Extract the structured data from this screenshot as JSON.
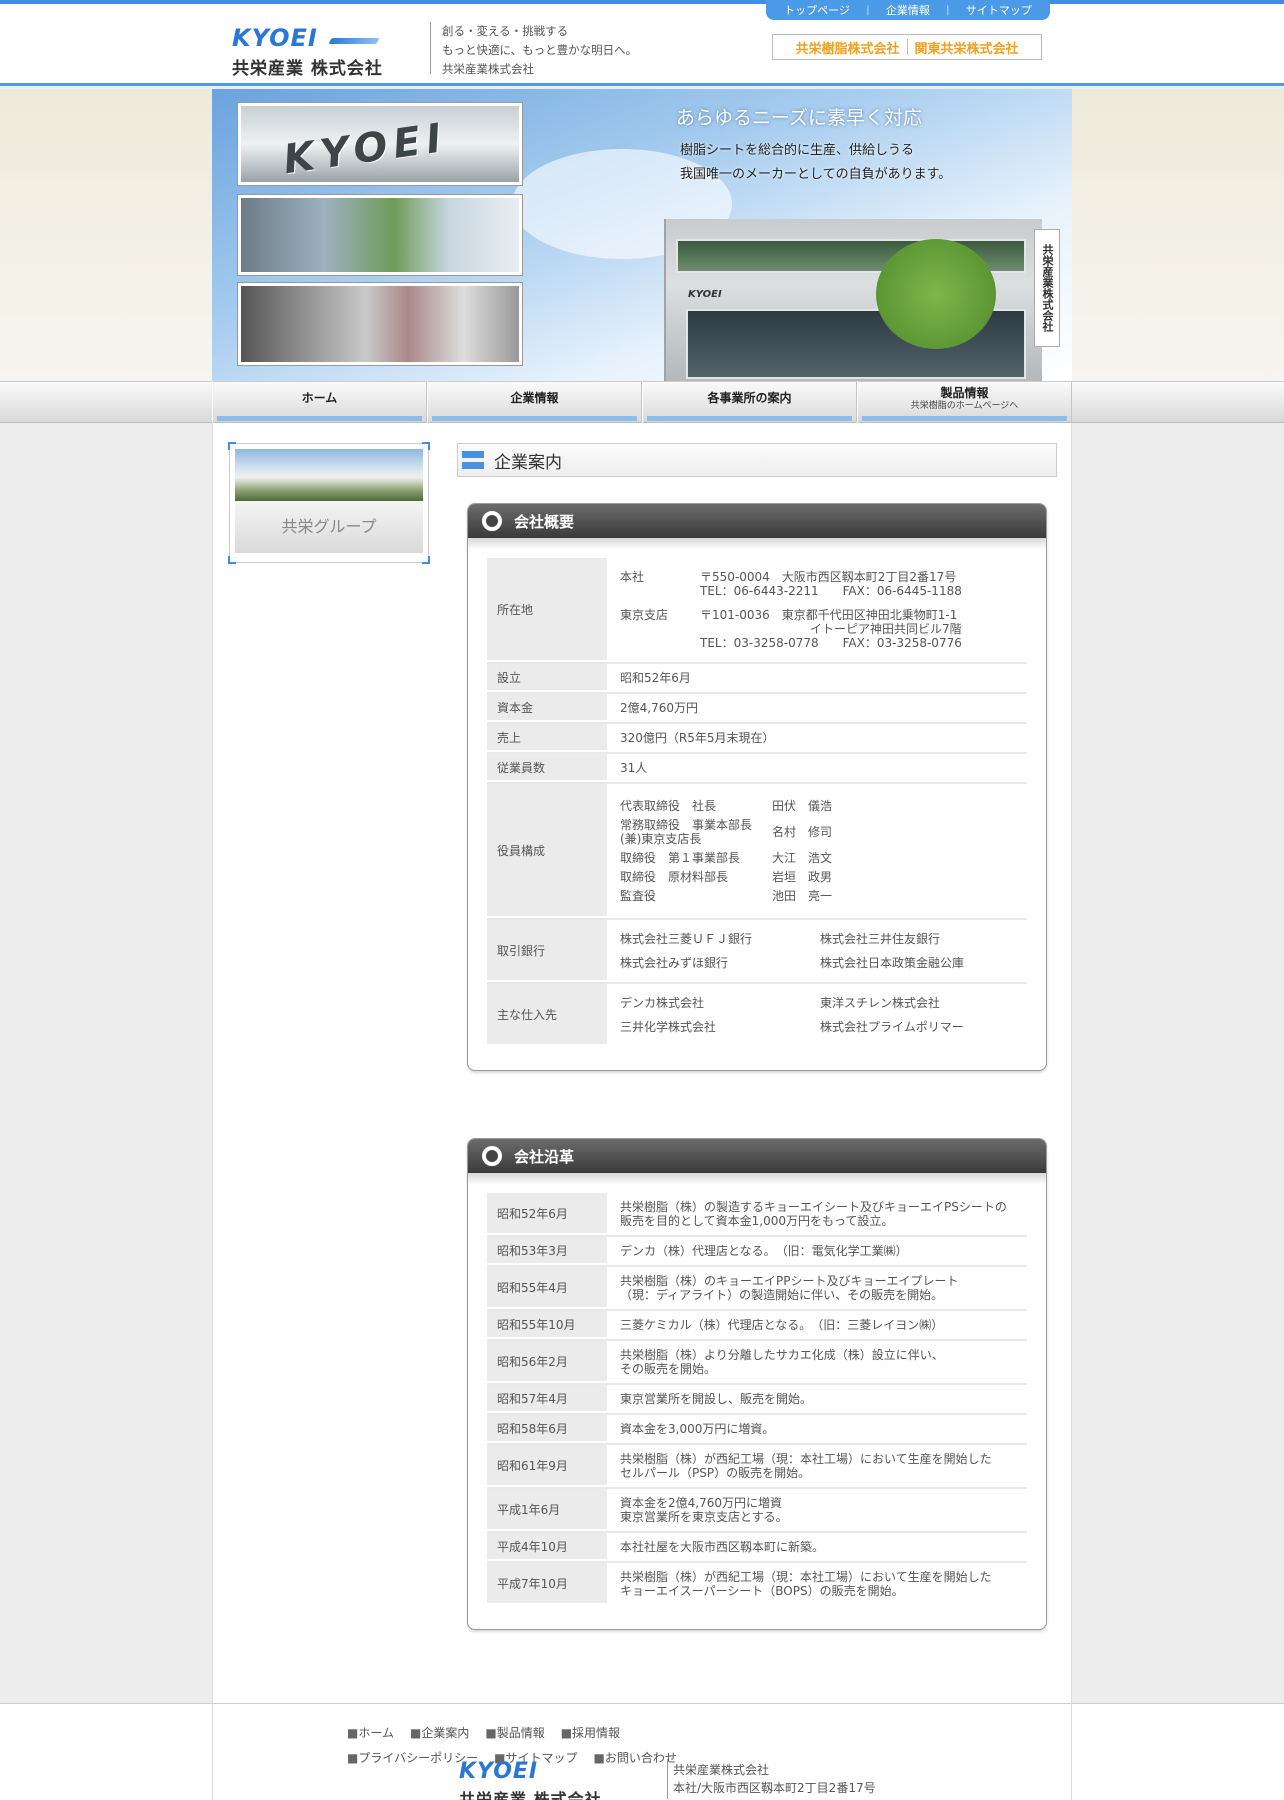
{
  "header": {
    "logo_en": "KYOEI",
    "logo_jp": "共栄産業 株式会社",
    "tagline": [
      "創る・変える・挑戦する",
      "もっと快適に、もっと豊かな明日へ。",
      "共栄産業株式会社"
    ],
    "top_nav": [
      "トップページ",
      "企業情報",
      "サイトマップ"
    ],
    "group_links": [
      "共栄樹脂株式会社",
      "関東共栄株式会社"
    ]
  },
  "hero": {
    "thumb_text": "KYOEI",
    "headline": "あらゆるニーズに素早く対応",
    "sub": [
      "樹脂シートを総合的に生産、供給しうる",
      "我国唯一のメーカーとしての自負があります。"
    ],
    "building_sign": "共栄産業株式会社",
    "building_logo": "KYOEI"
  },
  "global_nav": [
    {
      "label": "ホーム",
      "sub": ""
    },
    {
      "label": "企業情報",
      "sub": ""
    },
    {
      "label": "各事業所の案内",
      "sub": ""
    },
    {
      "label": "製品情報",
      "sub": "共栄樹脂のホームページへ"
    }
  ],
  "sidebar": {
    "banner_label": "共栄グループ"
  },
  "page_title": "企業案内",
  "overview": {
    "heading": "会社概要",
    "location_label": "所在地",
    "head_office": {
      "label": "本社",
      "lines": [
        "〒550-0004　大阪市西区靱本町2丁目2番17号",
        "TEL：06-6443-2211　　FAX：06-6445-1188"
      ]
    },
    "tokyo_branch": {
      "label": "東京支店",
      "lines": [
        "〒101-0036　東京都千代田区神田北乗物町1-1",
        "イトーピア神田共同ビル7階",
        "TEL：03-3258-0778　　FAX：03-3258-0776"
      ]
    },
    "rows": [
      {
        "label": "設立",
        "value": "昭和52年6月"
      },
      {
        "label": "資本金",
        "value": "2億4,760万円"
      },
      {
        "label": "売上",
        "value": "320億円（R5年5月末現在）"
      },
      {
        "label": "従業員数",
        "value": "31人"
      }
    ],
    "officers_label": "役員構成",
    "officers": [
      {
        "role": "代表取締役　社長",
        "name": "田伏　儀浩"
      },
      {
        "role": "常務取締役　事業本部長\n(兼)東京支店長",
        "name": "名村　修司"
      },
      {
        "role": "取締役　第１事業部長",
        "name": "大江　浩文"
      },
      {
        "role": "取締役　原材料部長",
        "name": "岩垣　政男"
      },
      {
        "role": "監査役",
        "name": "池田　亮一"
      }
    ],
    "banks_label": "取引銀行",
    "banks": [
      "株式会社三菱ＵＦＪ銀行",
      "株式会社三井住友銀行",
      "株式会社みずほ銀行",
      "株式会社日本政策金融公庫"
    ],
    "suppliers_label": "主な仕入先",
    "suppliers": [
      "デンカ株式会社",
      "東洋スチレン株式会社",
      "三井化学株式会社",
      "株式会社プライムポリマー"
    ]
  },
  "history": {
    "heading": "会社沿革",
    "rows": [
      {
        "date": "昭和52年6月",
        "text": "共栄樹脂（株）の製造するキョーエイシート及びキョーエイPSシートの\n販売を目的として資本金1,000万円をもって設立。"
      },
      {
        "date": "昭和53年3月",
        "text": "デンカ（株）代理店となる。　（旧：電気化学工業㈱）"
      },
      {
        "date": "昭和55年4月",
        "text": "共栄樹脂（株）のキョーエイPPシート及びキョーエイプレート\n（現：ディアライト）の製造開始に伴い、その販売を開始。"
      },
      {
        "date": "昭和55年10月",
        "text": "三菱ケミカル（株）代理店となる。　（旧：三菱レイヨン㈱）"
      },
      {
        "date": "昭和56年2月",
        "text": "共栄樹脂（株）より分離したサカエ化成（株）設立に伴い、\nその販売を開始。"
      },
      {
        "date": "昭和57年4月",
        "text": "東京営業所を開設し、販売を開始。"
      },
      {
        "date": "昭和58年6月",
        "text": "資本金を3,000万円に増資。"
      },
      {
        "date": "昭和61年9月",
        "text": "共栄樹脂（株）が西紀工場（現：本社工場）において生産を開始した\nセルパール（PSP）の販売を開始。"
      },
      {
        "date": "平成1年6月",
        "text": "資本金を2億4,760万円に増資\n東京営業所を東京支店とする。"
      },
      {
        "date": "平成4年10月",
        "text": "本社社屋を大阪市西区靱本町に新築。"
      },
      {
        "date": "平成7年10月",
        "text": "共栄樹脂（株）が西紀工場（現：本社工場）において生産を開始した\nキョーエイスーパーシート（BOPS）の販売を開始。"
      }
    ]
  },
  "footer": {
    "links": [
      "ホーム",
      "企業案内",
      "製品情報",
      "採用情報",
      "プライバシーポリシー",
      "サイトマップ",
      "お問い合わせ"
    ],
    "logo_en": "KYOEI",
    "logo_jp": "共栄産業 株式会社",
    "company": "共栄産業株式会社",
    "address": "本社/大阪市西区靱本町2丁目2番17号"
  }
}
